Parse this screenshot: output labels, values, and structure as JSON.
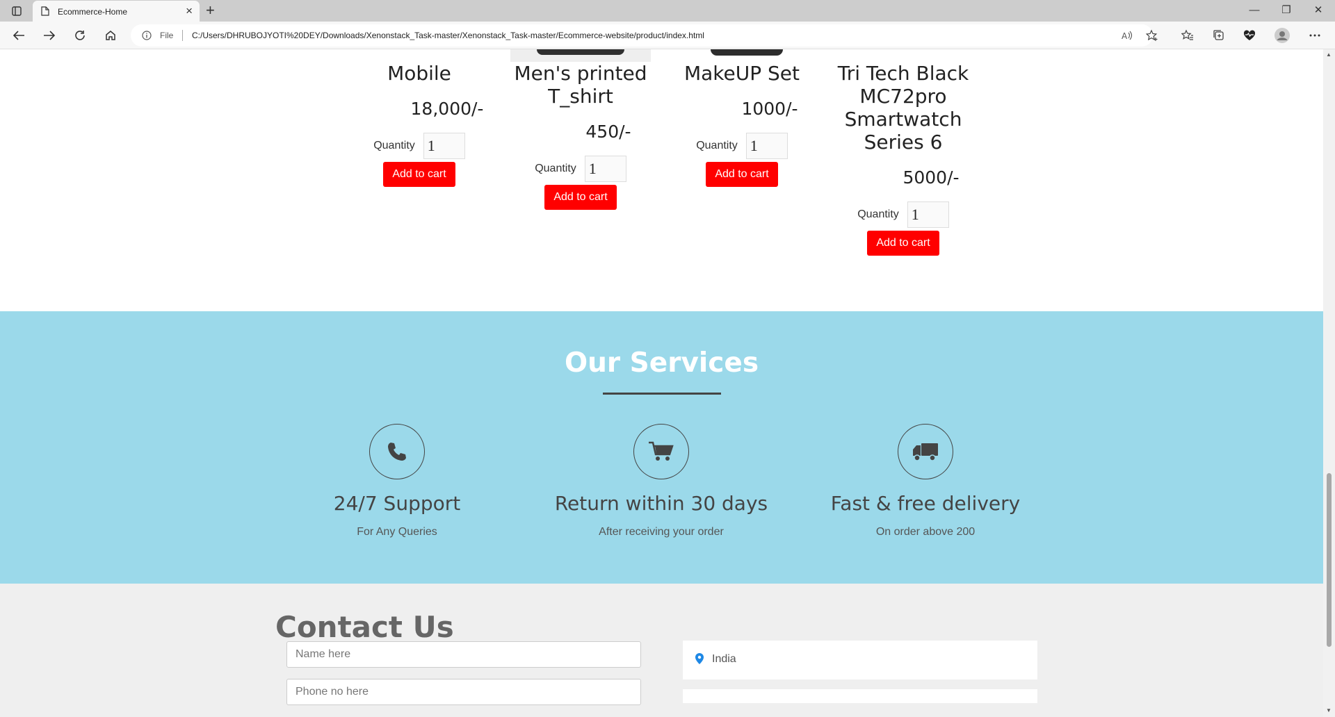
{
  "browser": {
    "tab_title": "Ecommerce-Home",
    "address_prefix": "File",
    "url": "C:/Users/DHRUBOJYOTI%20DEY/Downloads/Xenonstack_Task-master/Xenonstack_Task-master/Ecommerce-website/product/index.html"
  },
  "products": [
    {
      "name": "Mobile",
      "price": "18,000/-",
      "quantity_label": "Quantity",
      "quantity": "1",
      "button": "Add to cart"
    },
    {
      "name": "Men's printed T_shirt",
      "price": "450/-",
      "quantity_label": "Quantity",
      "quantity": "1",
      "button": "Add to cart"
    },
    {
      "name": "MakeUP Set",
      "price": "1000/-",
      "quantity_label": "Quantity",
      "quantity": "1",
      "button": "Add to cart"
    },
    {
      "name": "Tri Tech Black MC72pro Smartwatch Series 6",
      "price": "5000/-",
      "quantity_label": "Quantity",
      "quantity": "1",
      "button": "Add to cart"
    }
  ],
  "services": {
    "title": "Our Services",
    "items": [
      {
        "icon": "phone-icon",
        "heading": "24/7 Support",
        "sub": "For Any Queries"
      },
      {
        "icon": "cart-icon",
        "heading": "Return within 30 days",
        "sub": "After receiving your order"
      },
      {
        "icon": "truck-icon",
        "heading": "Fast & free delivery",
        "sub": "On order above 200"
      }
    ]
  },
  "contact": {
    "title": "Contact Us",
    "name_placeholder": "Name here",
    "phone_placeholder": "Phone no here",
    "location": "India"
  },
  "colors": {
    "services_bg": "#9bd9ea",
    "button_red": "#ff0000",
    "contact_bg": "#efefef"
  }
}
